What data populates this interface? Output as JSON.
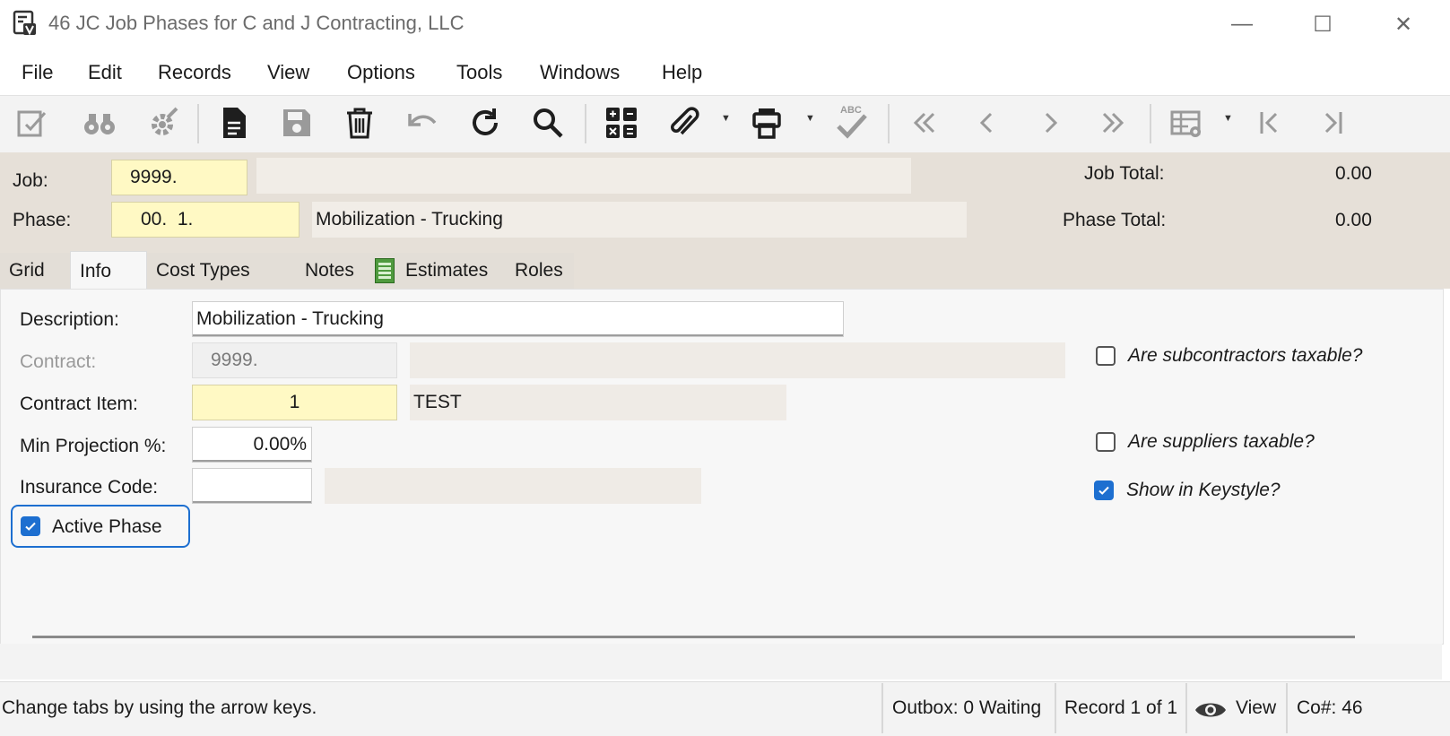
{
  "window": {
    "title": "46 JC Job Phases for C and J Contracting, LLC",
    "minimize": "—",
    "maximize": "☐",
    "close": "✕"
  },
  "menu": [
    "File",
    "Edit",
    "Records",
    "View",
    "Options",
    "Tools",
    "Windows",
    "Help"
  ],
  "toolbar": {
    "icons": [
      "edit-icon",
      "find-icon",
      "tools-icon",
      "new-record-icon",
      "save-icon",
      "delete-icon",
      "undo-icon",
      "refresh-icon",
      "search-icon",
      "calculator-icon",
      "attach-icon",
      "print-icon",
      "spellcheck-icon",
      "first-record-icon",
      "previous-record-icon",
      "next-record-icon",
      "last-record-icon",
      "grid-settings-icon",
      "jump-first-icon",
      "jump-last-icon"
    ],
    "spell_label": "ABC"
  },
  "header": {
    "job_label": "Job:",
    "job_value": "9999.",
    "job_desc": "",
    "job_total_label": "Job Total:",
    "job_total_value": "0.00",
    "phase_label": "Phase:",
    "phase_value": "00.  1.",
    "phase_desc": "Mobilization - Trucking",
    "phase_total_label": "Phase Total:",
    "phase_total_value": "0.00"
  },
  "tabs": [
    "Grid",
    "Info",
    "Cost Types",
    "Notes",
    "Estimates",
    "Roles"
  ],
  "active_tab": "Info",
  "form": {
    "description_label": "Description:",
    "description_value": "Mobilization - Trucking",
    "contract_label": "Contract:",
    "contract_value": "9999.",
    "contract_desc": "",
    "contract_item_label": "Contract Item:",
    "contract_item_value": "1",
    "contract_item_desc": "TEST",
    "min_projection_label": "Min Projection %:",
    "min_projection_value": "0.00%",
    "insurance_code_label": "Insurance Code:",
    "insurance_code_value": "",
    "insurance_desc": "",
    "active_phase_label": "Active Phase",
    "active_phase_checked": true,
    "subcontractors_taxable_label": "Are subcontractors taxable?",
    "subcontractors_taxable_checked": false,
    "suppliers_taxable_label": "Are suppliers taxable?",
    "suppliers_taxable_checked": false,
    "show_keystyle_label": "Show in Keystyle?",
    "show_keystyle_checked": true
  },
  "status": {
    "hint": "Change tabs by using the arrow keys.",
    "outbox": "Outbox: 0 Waiting",
    "record": "Record 1 of 1",
    "view": "View",
    "company": "Co#: 46"
  },
  "colors": {
    "header_bg": "#e6e0d8",
    "required_field": "#fff9c4",
    "checkbox_accent": "#1d6fd0",
    "focus_outline": "#1d6fd0"
  }
}
